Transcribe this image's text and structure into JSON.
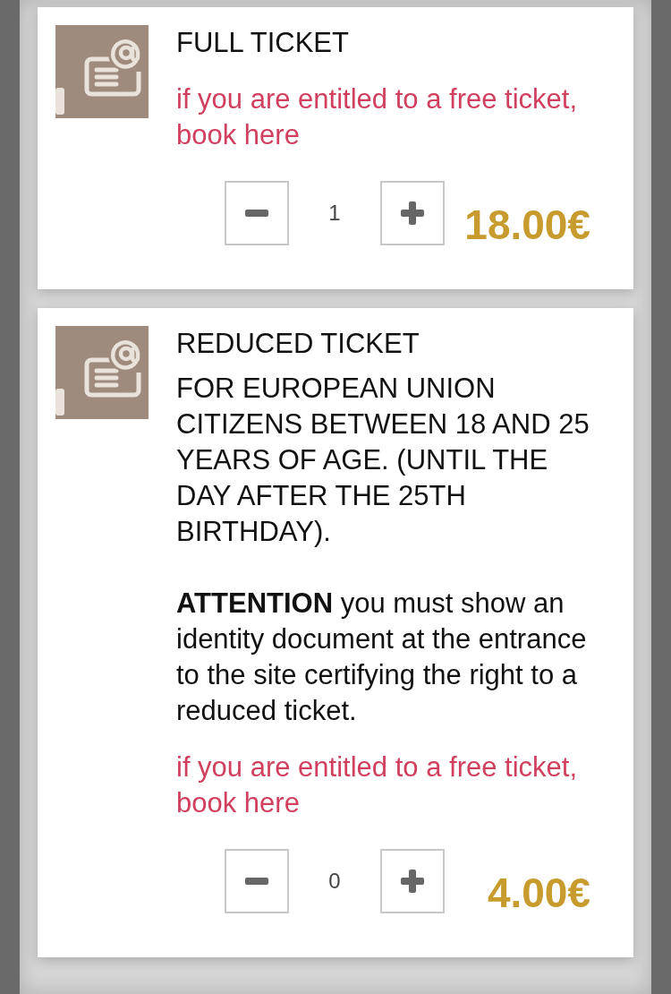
{
  "tickets": [
    {
      "title": "FULL TICKET",
      "free_link": "if you are entitled to a free ticket, book here",
      "quantity": "1",
      "price": "18.00€"
    },
    {
      "title": "REDUCED TICKET",
      "description": "FOR EUROPEAN UNION CITIZENS BETWEEN 18 AND 25 YEARS OF AGE. (UNTIL THE DAY AFTER THE 25TH BIRTHDAY).",
      "notice": "**ATTENTION** you must show an identity document at the entrance to the site certifying the right to a reduced ticket.",
      "free_link": "if you are entitled to a free ticket, book here",
      "quantity": "0",
      "price": "4.00€"
    }
  ]
}
